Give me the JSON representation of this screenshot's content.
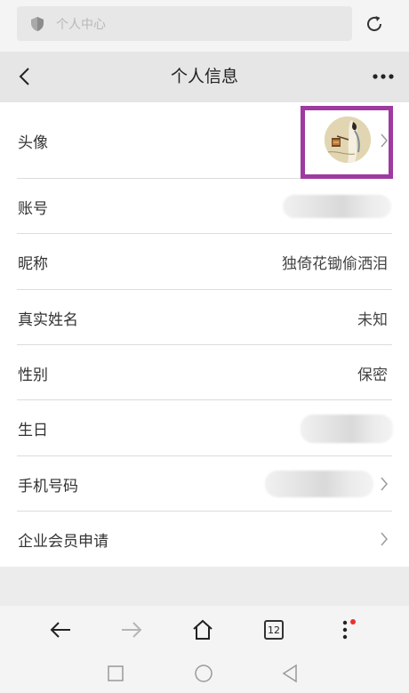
{
  "browser": {
    "url_text": "个人中心",
    "tabs_count": "12"
  },
  "header": {
    "title": "个人信息"
  },
  "rows": [
    {
      "label": "头像",
      "value": ""
    },
    {
      "label": "账号",
      "value": ""
    },
    {
      "label": "昵称",
      "value": "独倚花锄偷洒泪"
    },
    {
      "label": "真实姓名",
      "value": "未知"
    },
    {
      "label": "性别",
      "value": "保密"
    },
    {
      "label": "生日",
      "value": ""
    },
    {
      "label": "手机号码",
      "value": ""
    },
    {
      "label": "企业会员申请",
      "value": ""
    }
  ],
  "colors": {
    "highlight": "#9e3aa0",
    "notification_dot": "#e5322d"
  }
}
